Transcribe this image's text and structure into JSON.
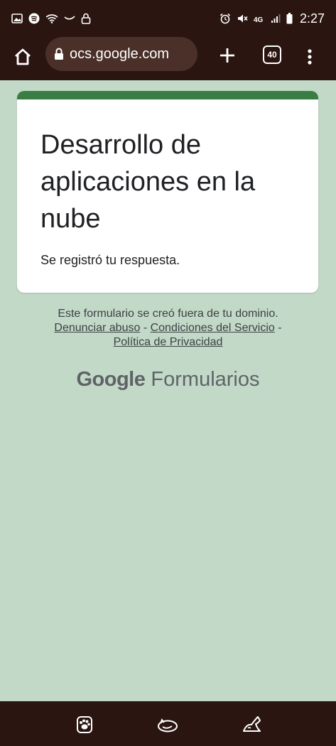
{
  "status_bar": {
    "time": "2:27",
    "left_icons": [
      "image-icon",
      "spotify-icon",
      "wifi-icon",
      "wave-icon",
      "lock-icon"
    ],
    "right_icons": [
      "alarm-icon",
      "mute-icon",
      "4g-icon",
      "signal-icon",
      "battery-icon"
    ]
  },
  "browser": {
    "url": "ocs.google.com",
    "tab_count": "40"
  },
  "form": {
    "title": "Desarrollo de aplicaciones en la nube",
    "response": "Se registró tu respuesta.",
    "accent_color": "#3a7d44"
  },
  "footer": {
    "notice": "Este formulario se creó fuera de tu dominio.",
    "report_abuse": "Denunciar abuso",
    "separator": " - ",
    "terms": "Condiciones del Servicio",
    "privacy": "Política de Privacidad"
  },
  "brand": {
    "google": "Google",
    "product": "Formularios"
  },
  "bottom_nav": {
    "icons": [
      "paw-icon",
      "sleeping-cat-icon",
      "stretching-cat-icon"
    ]
  }
}
